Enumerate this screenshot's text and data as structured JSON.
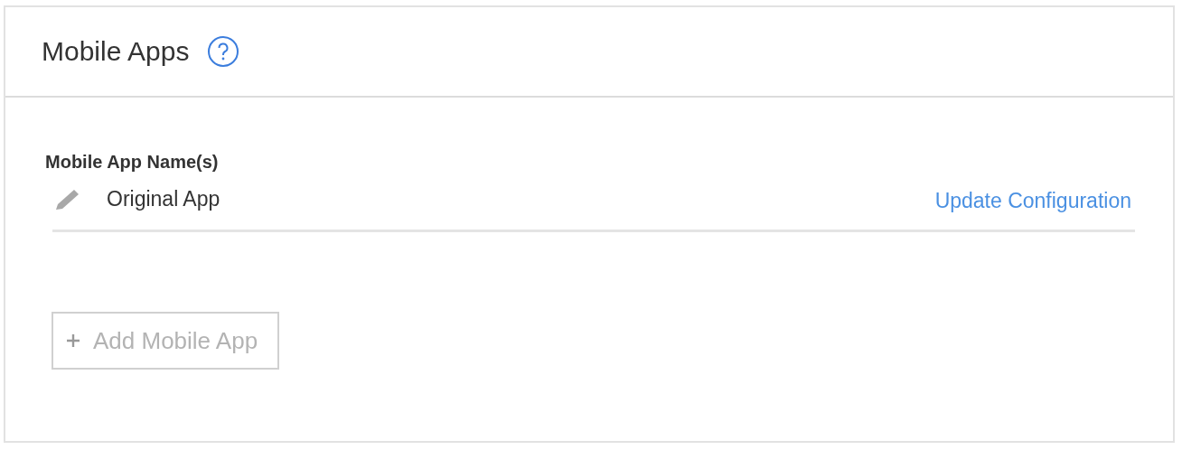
{
  "panel": {
    "title": "Mobile Apps"
  },
  "apps": {
    "label": "Mobile App Name(s)",
    "rows": [
      {
        "name": "Original App",
        "action": "Update Configuration"
      }
    ]
  },
  "add_button": {
    "label": "Add Mobile App",
    "disabled": true
  }
}
